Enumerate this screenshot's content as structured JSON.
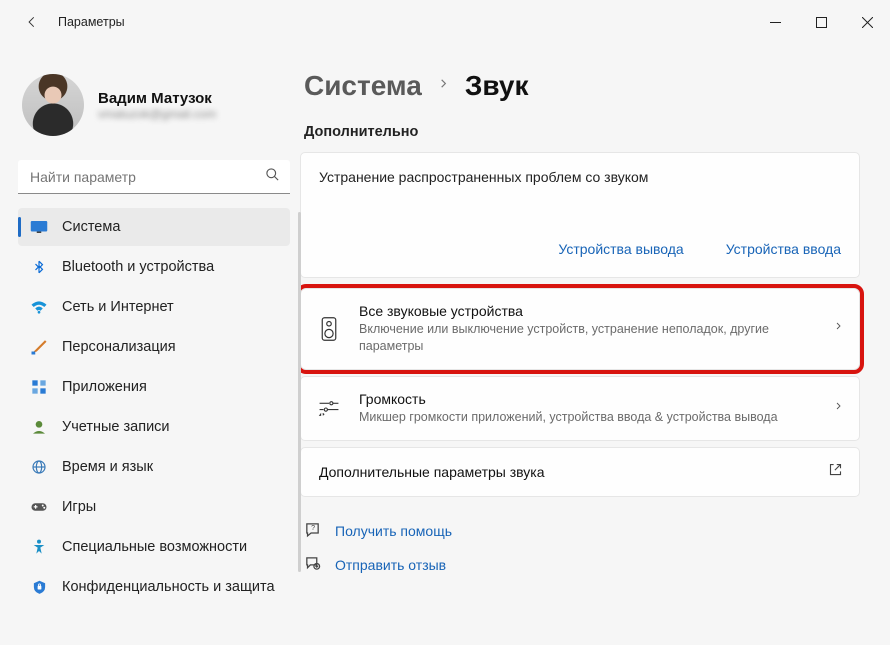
{
  "app_title": "Параметры",
  "profile": {
    "name": "Вадим Матузок",
    "email": "vmatuzok@gmail.com"
  },
  "search": {
    "placeholder": "Найти параметр"
  },
  "sidebar": {
    "items": [
      {
        "label": "Система",
        "icon": "display"
      },
      {
        "label": "Bluetooth и устройства",
        "icon": "bluetooth"
      },
      {
        "label": "Сеть и Интернет",
        "icon": "wifi"
      },
      {
        "label": "Персонализация",
        "icon": "brush"
      },
      {
        "label": "Приложения",
        "icon": "apps"
      },
      {
        "label": "Учетные записи",
        "icon": "person"
      },
      {
        "label": "Время и язык",
        "icon": "globe"
      },
      {
        "label": "Игры",
        "icon": "gamepad"
      },
      {
        "label": "Специальные возможности",
        "icon": "accessibility"
      },
      {
        "label": "Конфиденциальность и защита",
        "icon": "shield"
      }
    ]
  },
  "breadcrumb": {
    "parent": "Система",
    "current": "Звук"
  },
  "section_label": "Дополнительно",
  "troubleshoot": {
    "title": "Устранение распространенных проблем со звуком",
    "output_link": "Устройства вывода",
    "input_link": "Устройства ввода"
  },
  "settings": {
    "all_devices": {
      "title": "Все звуковые устройства",
      "desc": "Включение или выключение устройств, устранение неполадок, другие параметры"
    },
    "volume": {
      "title": "Громкость",
      "desc": "Микшер громкости приложений, устройства ввода & устройства вывода"
    },
    "more": {
      "title": "Дополнительные параметры звука"
    }
  },
  "footer": {
    "help": "Получить помощь",
    "feedback": "Отправить отзыв"
  }
}
